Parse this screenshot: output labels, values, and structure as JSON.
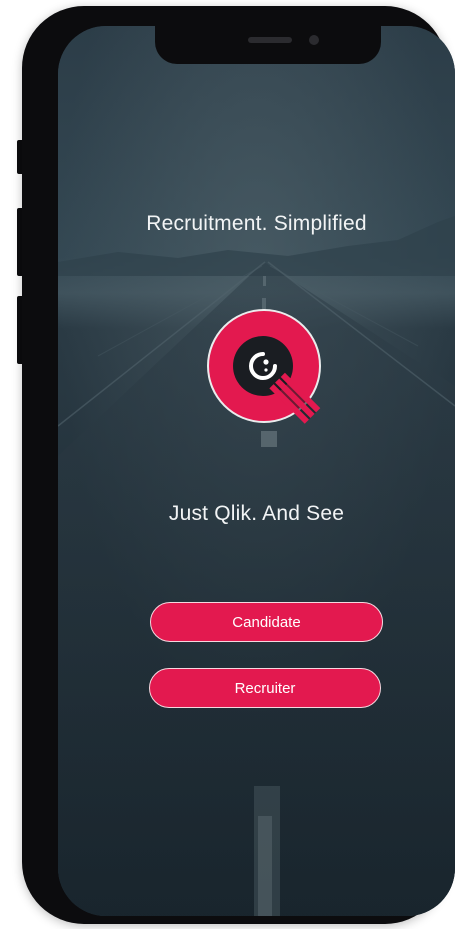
{
  "app": {
    "tagline_top": "Recruitment. Simplified",
    "tagline_bottom": "Just Qlik. And See",
    "logo_icon": "qlik-logo-icon",
    "accent_color": "#e3194f"
  },
  "actions": {
    "candidate_label": "Candidate",
    "recruiter_label": "Recruiter"
  }
}
